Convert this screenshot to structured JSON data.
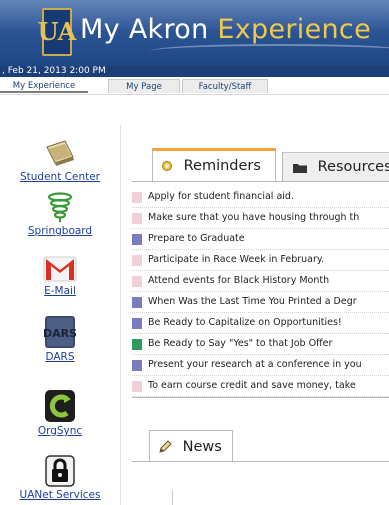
{
  "header": {
    "logo_text": "UA",
    "title_part1": "My Akron",
    "title_part2": "Experience",
    "datetime": ", Feb 21, 2013 2:00 PM"
  },
  "nav_tabs": [
    {
      "label": "My Experience",
      "active": true
    },
    {
      "label": "My Page",
      "active": false
    },
    {
      "label": "Faculty/Staff",
      "active": false
    }
  ],
  "sidebar": {
    "items": [
      {
        "label": "Student Center",
        "icon": "student-center-icon"
      },
      {
        "label": "Springboard",
        "icon": "springboard-icon"
      },
      {
        "label": "E-Mail",
        "icon": "gmail-icon"
      },
      {
        "label": "DARS",
        "icon": "dars-icon"
      },
      {
        "label": "OrgSync",
        "icon": "orgsync-icon"
      },
      {
        "label": "UANet Services",
        "icon": "lock-icon"
      }
    ]
  },
  "panel": {
    "tabs": [
      {
        "label": "Reminders",
        "icon": "gear-icon",
        "active": true
      },
      {
        "label": "Resources",
        "icon": "folder-icon",
        "active": false
      }
    ],
    "reminders": [
      {
        "text": "Apply for student financial aid.",
        "color": "#f3d0d6"
      },
      {
        "text": "Make sure that you have housing through th",
        "color": "#f3d0d6"
      },
      {
        "text": "Prepare to Graduate",
        "color": "#7b7bc0"
      },
      {
        "text": "Participate in Race Week in February.",
        "color": "#f3d0d6"
      },
      {
        "text": "Attend events for Black History Month",
        "color": "#f3d0d6"
      },
      {
        "text": "When Was the Last Time You Printed a Degr",
        "color": "#7b7bc0"
      },
      {
        "text": "Be Ready to Capitalize on Opportunities!",
        "color": "#7b7bc0"
      },
      {
        "text": "Be Ready to Say \"Yes\" to that Job Offer",
        "color": "#2e9a5e"
      },
      {
        "text": "Present your research at a conference in you",
        "color": "#7b7bc0"
      },
      {
        "text": "To earn course credit and save money, take",
        "color": "#f3d0d6"
      }
    ]
  },
  "news": {
    "label": "News",
    "icon": "pencil-icon"
  }
}
